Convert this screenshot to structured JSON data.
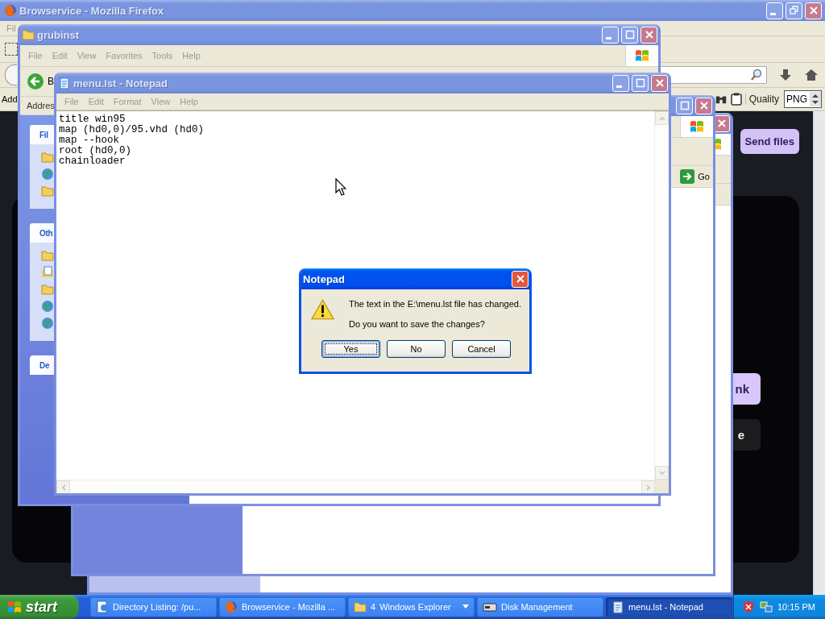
{
  "firefox": {
    "title": "Browservice - Mozilla Firefox",
    "active": false,
    "menu": "Fil",
    "bar_label": "Add",
    "quality_label": "Quality",
    "quality_value": "PNG",
    "send_button": "Send files",
    "panel_buttons": [
      {
        "label": "nk",
        "kind": "accent"
      },
      {
        "label": "e",
        "kind": "dark"
      }
    ]
  },
  "explorer_windows": [
    {
      "active": false
    },
    {
      "active": false,
      "go_button": "Go"
    }
  ],
  "grubinst": {
    "title": "grubinst",
    "active": false,
    "menu": [
      "File",
      "Edit",
      "View",
      "Favorites",
      "Tools",
      "Help"
    ],
    "back_label": "B",
    "address_label": "Addres",
    "panes": [
      {
        "title": "Fil"
      },
      {
        "title": "Oth"
      },
      {
        "title": "De"
      }
    ]
  },
  "notepad": {
    "title": "menu.lst - Notepad",
    "active": false,
    "menu": [
      "File",
      "Edit",
      "Format",
      "View",
      "Help"
    ],
    "lines": [
      "title win95",
      "map (hd0,0)/95.vhd (hd0)",
      "map --hook",
      "root (hd0,0)",
      "chainloader"
    ]
  },
  "dialog": {
    "title": "Notepad",
    "active": true,
    "message": "The text in the E:\\menu.lst file has changed.",
    "question": "Do you want to save the changes?",
    "buttons": [
      {
        "label": "Yes",
        "selected": true
      },
      {
        "label": "No",
        "selected": false
      },
      {
        "label": "Cancel",
        "selected": false
      }
    ]
  },
  "taskbar": {
    "start": "start",
    "clock": "10:15 PM",
    "tasks": [
      {
        "label": "Directory Listing: /pu...",
        "selected": false
      },
      {
        "label": "Browservice - Mozilla ...",
        "selected": false
      },
      {
        "label": "Windows Explorer",
        "count": "4",
        "selected": false
      },
      {
        "label": "Disk Management",
        "selected": false
      },
      {
        "label": "menu.lst - Notepad",
        "selected": true
      }
    ]
  }
}
